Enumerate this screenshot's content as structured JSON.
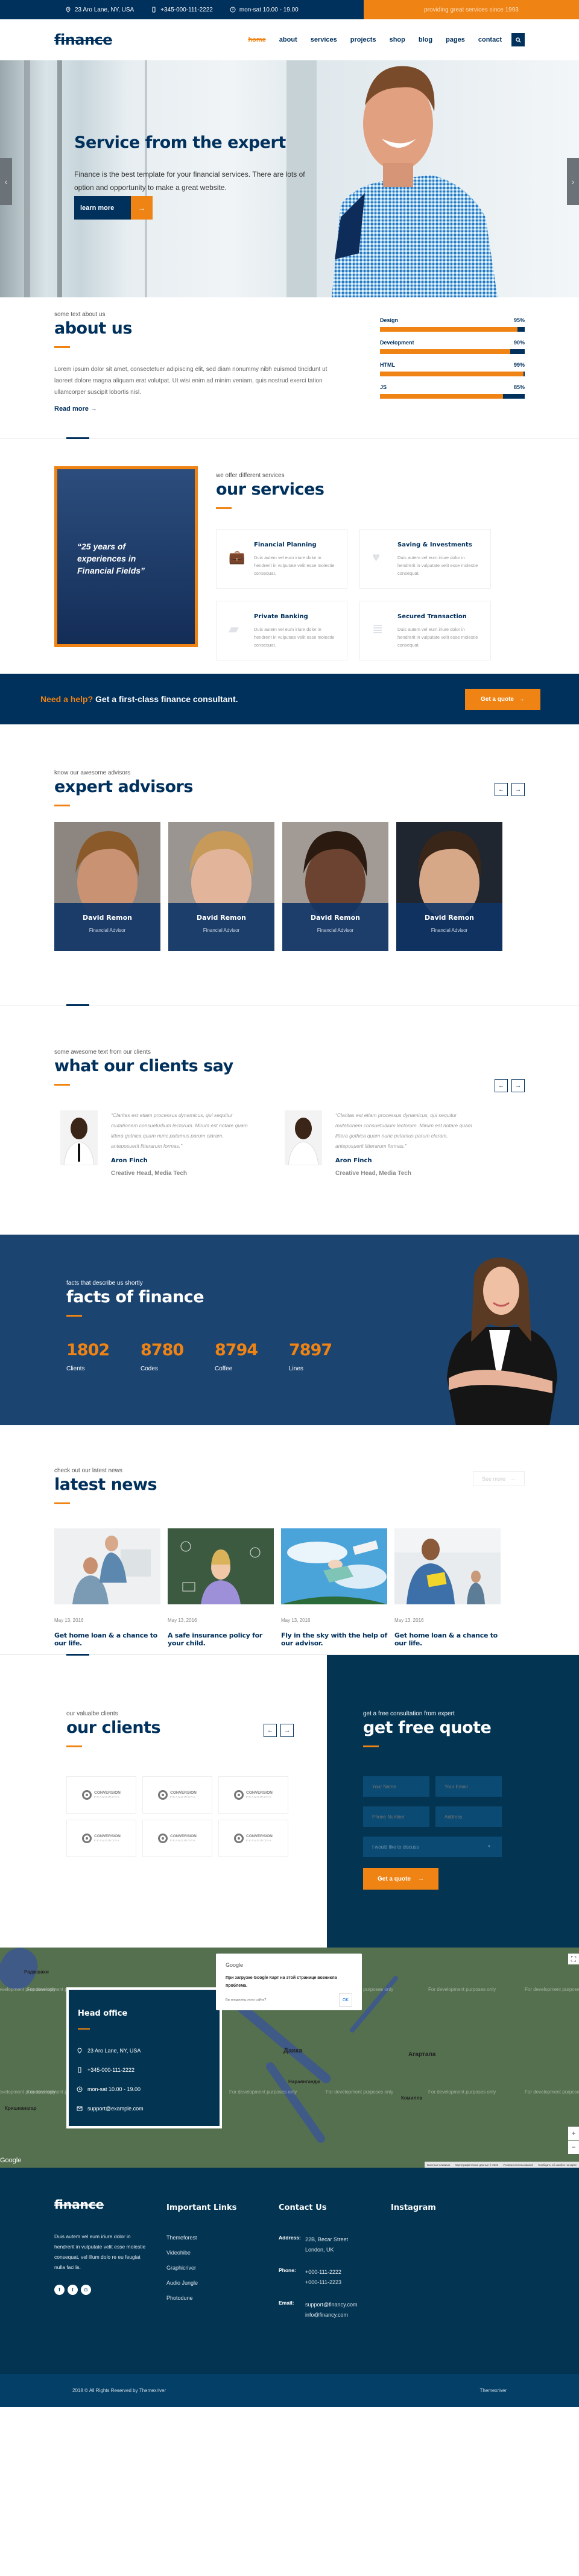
{
  "topbar": {
    "address": "23 Aro Lane, NY, USA",
    "phone": "+345-000-111-2222",
    "hours": "mon-sat 10.00 - 19.00",
    "tagline": "providing great services since 1993"
  },
  "header": {
    "logo": "finance",
    "nav": [
      {
        "label": "home",
        "active": true
      },
      {
        "label": "about"
      },
      {
        "label": "services"
      },
      {
        "label": "projects"
      },
      {
        "label": "shop"
      },
      {
        "label": "blog"
      },
      {
        "label": "pages"
      },
      {
        "label": "contact"
      }
    ],
    "search_icon": "search-icon"
  },
  "hero": {
    "title": "Service from the expert",
    "text": "Finance is the best template for your financial services. There are lots of option and opportunity to make a great website.",
    "button": "learn more",
    "arrow": "→",
    "prev": "‹",
    "next": "›"
  },
  "about": {
    "kicker": "some text about us",
    "title": "about us",
    "text": "Lorem ipsum dolor sit amet, consectetuer adipiscing elit, sed diam nonummy nibh euismod tincidunt ut laoreet dolore magna aliquam erat volutpat. Ut wisi enim ad minim veniam, quis nostrud exerci tation ullamcorper suscipit lobortis nisl.",
    "read_more": "Read more →",
    "skills": [
      {
        "name": "Design",
        "label": "95%",
        "value": 95
      },
      {
        "name": "Development",
        "label": "90%",
        "value": 90
      },
      {
        "name": "HTML",
        "label": "99%",
        "value": 99
      },
      {
        "name": "JS",
        "label": "85%",
        "value": 85
      }
    ]
  },
  "services": {
    "quote": "“25 years of experiences in Financial Fields”",
    "kicker": "we offer different services",
    "title": "our services",
    "items": [
      {
        "title": "Financial Planning",
        "icon": "briefcase-icon",
        "glyph": "💼",
        "text": "Duis autem vel eum iriure dolor in hendrerit in vulputate velit esse molestie consequat."
      },
      {
        "title": "Saving & Investments",
        "icon": "heart-icon",
        "glyph": "♥",
        "text": "Duis autem vel eum iriure dolor in hendrerit in vulputate velit esse molestie consequat."
      },
      {
        "title": "Private Banking",
        "icon": "folder-icon",
        "glyph": "▰",
        "text": "Duis autem vel eum iriure dolor in hendrerit in vulputate velit esse molestie consequat."
      },
      {
        "title": "Secured Transaction",
        "icon": "stack-icon",
        "glyph": "≣",
        "text": "Duis autem vel eum iriure dolor in hendrerit in vulputate velit esse molestie consequat."
      }
    ]
  },
  "cta": {
    "highlight": "Need a help?",
    "text": " Get a first-class finance consultant.",
    "button": "Get a quote",
    "arrow": "→"
  },
  "advisors": {
    "kicker": "know our awesome advisors",
    "title": "expert advisors",
    "prev": "←",
    "next": "→",
    "items": [
      {
        "name": "David Remon",
        "role": "Financial Advisor"
      },
      {
        "name": "David Remon",
        "role": "Financial Advisor"
      },
      {
        "name": "David Remon",
        "role": "Financial Advisor"
      },
      {
        "name": "David Remon",
        "role": "Financial Advisor"
      }
    ]
  },
  "testimonials": {
    "kicker": "some awesome text from our clients",
    "title": "what our clients say",
    "prev": "←",
    "next": "→",
    "items": [
      {
        "quote": "“Claritas est etiam processus dynamicus, qui sequitur mutationem consuetudium lectorum. Mirum est notare quam littera gothica quam nunc putamus parum claram, anteposuerit litterarum formas.”",
        "name": "Aron Finch",
        "role": "Creative Head, Media Tech"
      },
      {
        "quote": "“Claritas est etiam processus dynamicus, qui sequitur mutationem consuetudium lectorum. Mirum est notare quam littera gothica quam nunc putamus parum claram, anteposuerit litterarum formas.”",
        "name": "Aron Finch",
        "role": "Creative Head, Media Tech"
      }
    ]
  },
  "facts": {
    "kicker": "facts that describe us shortly",
    "title": "facts of finance",
    "items": [
      {
        "number": "1802",
        "label": "Clients"
      },
      {
        "number": "8780",
        "label": "Codes"
      },
      {
        "number": "8794",
        "label": "Coffee"
      },
      {
        "number": "7897",
        "label": "Lines"
      }
    ]
  },
  "news": {
    "kicker": "check out our latest news",
    "title": "latest news",
    "see_more": "See more",
    "arrow": "→",
    "items": [
      {
        "date": "May 13, 2016",
        "title": "Get home loan & a chance to our life."
      },
      {
        "date": "May 13, 2016",
        "title": "A safe insurance policy for your child."
      },
      {
        "date": "May 13, 2016",
        "title": "Fly in the sky with the help of our advisor."
      },
      {
        "date": "May 13, 2016",
        "title": "Get home loan & a chance to our life."
      }
    ]
  },
  "clients": {
    "kicker": "our valualbe clients",
    "title": "our clients",
    "prev": "←",
    "next": "→",
    "logo_name": "CONVERSION",
    "logo_sub": "FRAMEWORK",
    "count": 6
  },
  "quote_form": {
    "kicker": "get a free consultation from expert",
    "title": "get free quote",
    "name_placeholder": "Your Name",
    "email_placeholder": "Your Email",
    "phone_placeholder": "Phone Number",
    "address_placeholder": "Address",
    "discuss_selected": "I would like to discuss",
    "button": "Get a quote",
    "arrow": "→"
  },
  "map": {
    "office_title": "Head office",
    "address": "23 Aro Lane, NY, USA",
    "phone": "+345-000-111-2222",
    "hours": "mon-sat 10.00 - 19.00",
    "email": "support@example.com",
    "dev_watermark": "For development purposes only",
    "cities": [
      "Раджшахи",
      "Дакка",
      "Нараянгандж",
      "Агартала",
      "Комилла",
      "Кришнанагар"
    ],
    "dialog": {
      "brand": "Google",
      "message": "При загрузке Google Карт на этой странице возникла проблема.",
      "owner": "Вы владелец этого сайта?",
      "ok": "OK"
    },
    "google_logo": "Google",
    "footer_links": [
      "Быстрые клавиши",
      "Картографические данные © 2023",
      "Условия использования",
      "Сообщить об ошибке на карте"
    ],
    "zoom_in": "+",
    "zoom_out": "−",
    "fullscreen": "⛶"
  },
  "footer": {
    "logo": "finance",
    "desc": "Duis autem vel eum iriure dolor in hendrerit in vulputate velit esse molestie consequat, vel illum dolo re eu feugiat nulla facilis.",
    "social": [
      {
        "icon": "facebook-icon",
        "glyph": "f"
      },
      {
        "icon": "twitter-icon",
        "glyph": "t"
      },
      {
        "icon": "instagram-icon",
        "glyph": "◘"
      }
    ],
    "links_title": "Important Links",
    "links": [
      "Themeforest",
      "Videohibe",
      "Graphicriver",
      "Audio Jungle",
      "Photodune"
    ],
    "contact_title": "Contact Us",
    "contact": [
      {
        "label": "Address:",
        "lines": [
          "22B, Becar Street",
          "London, UK"
        ]
      },
      {
        "label": "Phone:",
        "lines": [
          "+000-111-2222",
          "+000-111-2223"
        ]
      },
      {
        "label": "Email:",
        "lines": [
          "support@financy.com",
          "info@financy.com"
        ]
      }
    ],
    "instagram_title": "Instagram",
    "copyright": "2018 © All Rights Reserved by Themexriver",
    "credit": "Themexriver"
  },
  "colors": {
    "navy": "#00305c",
    "orange": "#ef8314",
    "facts_bg": "#1b4470",
    "footer_bg": "#033452"
  }
}
